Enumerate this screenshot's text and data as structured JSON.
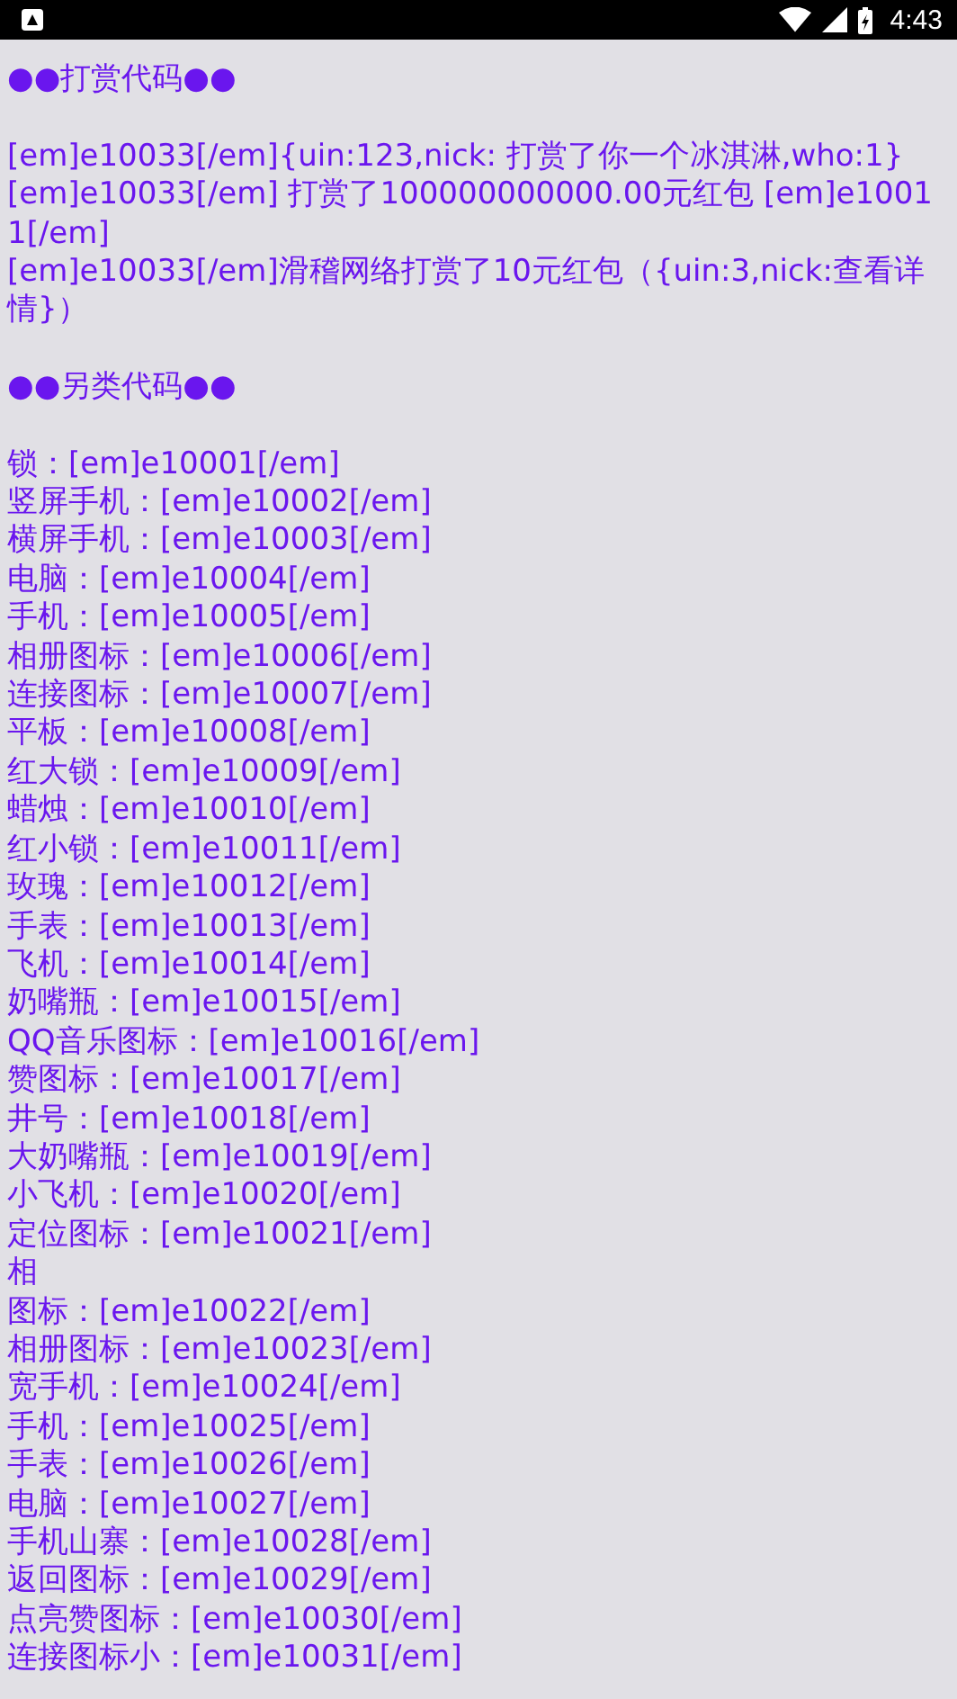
{
  "status_bar": {
    "time": "4:43"
  },
  "sections": [
    {
      "heading": "●●打赏代码●●",
      "lines": [
        "[em]e10033[/em]{uin:123,nick: 打赏了你一个冰淇淋,who:1}",
        "[em]e10033[/em] 打赏了100000000000.00元红包 [em]e10011[/em]",
        "[em]e10033[/em]滑稽网络打赏了10元红包（{uin:3,nick:查看详情}）"
      ]
    },
    {
      "heading": "●●另类代码●●",
      "lines": [
        "锁：[em]e10001[/em]",
        "竖屏手机：[em]e10002[/em]",
        "横屏手机：[em]e10003[/em]",
        "电脑：[em]e10004[/em]",
        "手机：[em]e10005[/em]",
        "相册图标：[em]e10006[/em]",
        "连接图标：[em]e10007[/em]",
        "平板：[em]e10008[/em]",
        "红大锁：[em]e10009[/em]",
        "蜡烛：[em]e10010[/em]",
        "红小锁：[em]e10011[/em]",
        "玫瑰：[em]e10012[/em]",
        "手表：[em]e10013[/em]",
        "飞机：[em]e10014[/em]",
        "奶嘴瓶：[em]e10015[/em]",
        "QQ音乐图标：[em]e10016[/em]",
        "赞图标：[em]e10017[/em]",
        "井号：[em]e10018[/em]",
        "大奶嘴瓶：[em]e10019[/em]",
        "小飞机：[em]e10020[/em]",
        "定位图标：[em]e10021[/em]",
        "相",
        "图标：[em]e10022[/em]",
        "相册图标：[em]e10023[/em]",
        "宽手机：[em]e10024[/em]",
        "手机：[em]e10025[/em]",
        "手表：[em]e10026[/em]",
        "电脑：[em]e10027[/em]",
        "手机山寨：[em]e10028[/em]",
        "返回图标：[em]e10029[/em]",
        "点亮赞图标：[em]e10030[/em]",
        "连接图标小：[em]e10031[/em]"
      ]
    }
  ]
}
